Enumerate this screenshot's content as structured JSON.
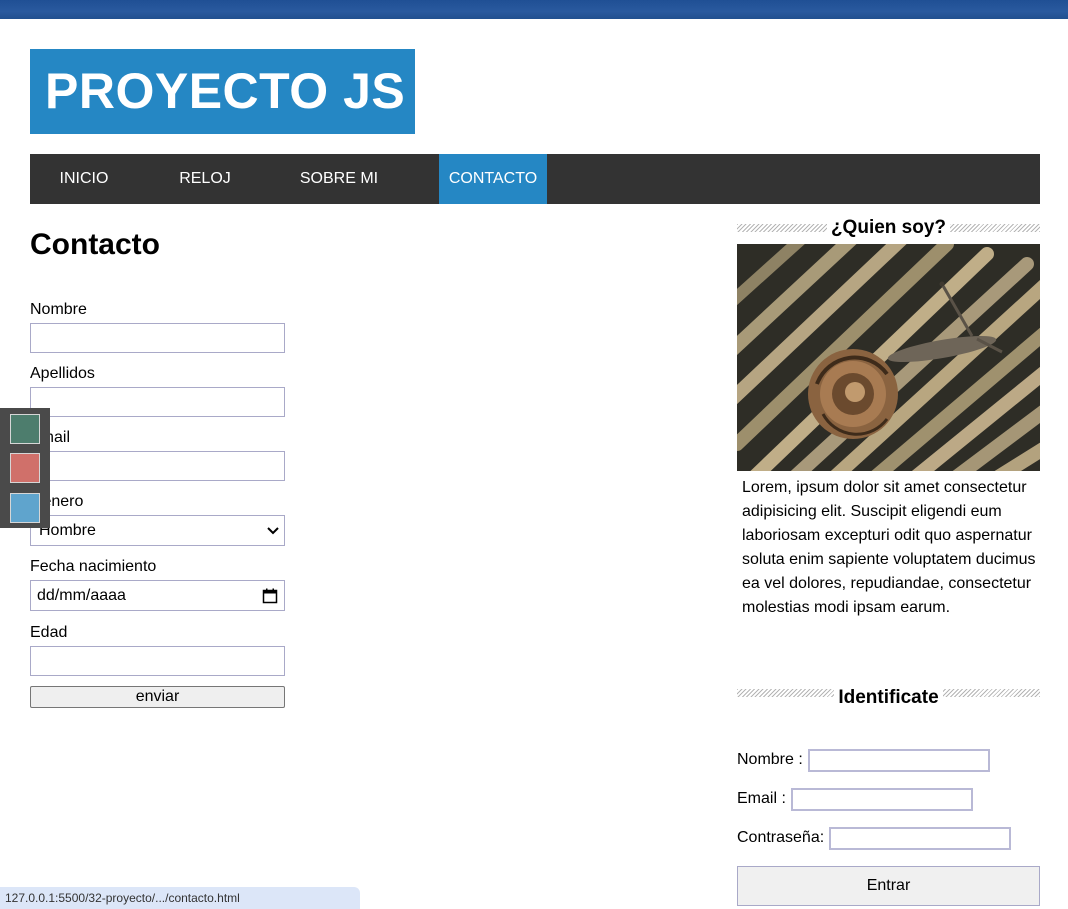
{
  "logo": {
    "text": "PROYECTO JS"
  },
  "nav": {
    "items": [
      {
        "label": "INICIO"
      },
      {
        "label": "RELOJ"
      },
      {
        "label": "SOBRE MI"
      },
      {
        "label": "CONTACTO"
      }
    ],
    "active": "CONTACTO"
  },
  "main": {
    "title": "Contacto",
    "form": {
      "nombre_label": "Nombre",
      "nombre_value": "",
      "apellidos_label": "Apellidos",
      "apellidos_value": "",
      "email_label": "Email",
      "email_value": "",
      "genero_label": "Genero",
      "genero_selected": "Hombre",
      "fecha_label": "Fecha nacimiento",
      "fecha_placeholder": "dd/mm/aaaa",
      "edad_label": "Edad",
      "edad_value": "",
      "submit_label": "enviar"
    }
  },
  "theme_swatches": [
    "#4d7d6d",
    "#d0706a",
    "#5fa4cd"
  ],
  "sidebar": {
    "about": {
      "heading": "¿Quien soy?",
      "text": "Lorem, ipsum dolor sit amet consectetur adipisicing elit. Suscipit eligendi eum laboriosam excepturi odit quo aspernatur soluta enim sapiente voluptatem ducimus ea vel dolores, repudiandae, consectetur molestias modi ipsam earum."
    },
    "login": {
      "heading": "Identificate",
      "nombre_label": "Nombre :",
      "email_label": "Email :",
      "password_label": "Contraseña:",
      "submit_label": "Entrar"
    }
  },
  "colors": {
    "accent": "#2587c4",
    "nav_bg": "#333333",
    "top_bar": "#22508f"
  },
  "status_bar": {
    "url": "127.0.0.1:5500/32-proyecto/.../contacto.html"
  }
}
